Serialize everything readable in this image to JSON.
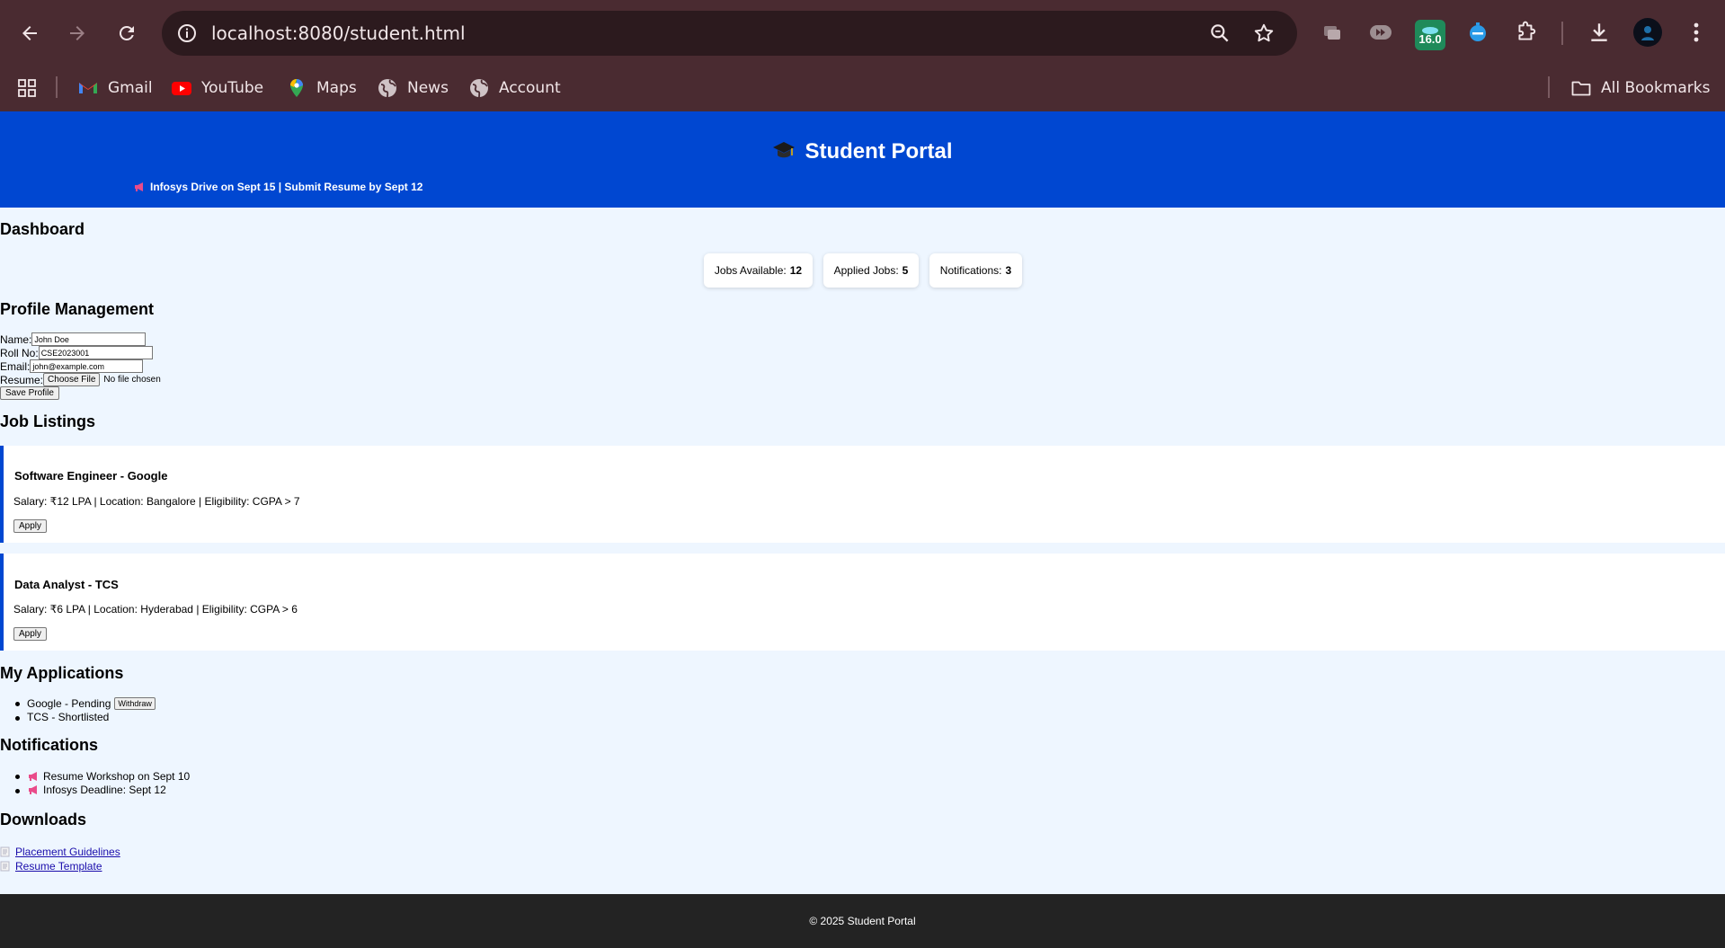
{
  "browser": {
    "url_host": "localhost:8080",
    "url_path": "/student.html",
    "extension_badge": "16.0",
    "bookmarks": [
      {
        "label": "Gmail",
        "icon": "gmail-icon"
      },
      {
        "label": "YouTube",
        "icon": "youtube-icon"
      },
      {
        "label": "Maps",
        "icon": "maps-icon"
      },
      {
        "label": "News",
        "icon": "globe-icon"
      },
      {
        "label": "Account",
        "icon": "globe-icon"
      }
    ],
    "all_bookmarks": "All Bookmarks"
  },
  "header": {
    "title": "Student Portal",
    "announcement": "Infosys Drive on Sept 15 | Submit Resume by Sept 12"
  },
  "dashboard": {
    "heading": "Dashboard",
    "stats": [
      {
        "label": "Jobs Available:",
        "value": "12"
      },
      {
        "label": "Applied Jobs:",
        "value": "5"
      },
      {
        "label": "Notifications:",
        "value": "3"
      }
    ]
  },
  "profile": {
    "heading": "Profile Management",
    "name_label": "Name:",
    "name_value": "John Doe",
    "roll_label": "Roll No:",
    "roll_value": "CSE2023001",
    "email_label": "Email:",
    "email_value": "john@example.com",
    "resume_label": "Resume:",
    "choose_file": "Choose File",
    "no_file": "No file chosen",
    "save_button": "Save Profile"
  },
  "jobs": {
    "heading": "Job Listings",
    "items": [
      {
        "title": "Software Engineer - Google",
        "info": "Salary: ₹12 LPA | Location: Bangalore | Eligibility: CGPA > 7",
        "apply": "Apply"
      },
      {
        "title": "Data Analyst - TCS",
        "info": "Salary: ₹6 LPA | Location: Hyderabad | Eligibility: CGPA > 6",
        "apply": "Apply"
      }
    ]
  },
  "applications": {
    "heading": "My Applications",
    "items": [
      {
        "text": "Google - Pending",
        "action": "Withdraw"
      },
      {
        "text": "TCS - Shortlisted"
      }
    ]
  },
  "notifications": {
    "heading": "Notifications",
    "items": [
      "Resume Workshop on Sept 10",
      "Infosys Deadline: Sept 12"
    ]
  },
  "downloads": {
    "heading": "Downloads",
    "items": [
      "Placement Guidelines",
      "Resume Template"
    ]
  },
  "footer": {
    "text": "© 2025 Student Portal"
  },
  "colors": {
    "header_blue": "#0047d1",
    "page_bg": "#eef6ff",
    "footer_bg": "#232323",
    "chrome_bg": "#4a2b31"
  }
}
